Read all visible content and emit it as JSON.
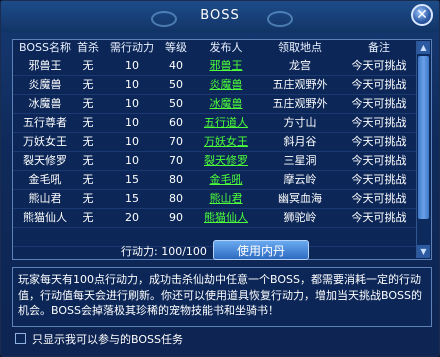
{
  "window": {
    "title": "BOSS",
    "close_glyph": "✕"
  },
  "table": {
    "headers": [
      "BOSS名称",
      "首杀",
      "需行动力",
      "等级",
      "发布人",
      "领取地点",
      "备注"
    ],
    "rows": [
      [
        "邪兽王",
        "无",
        "10",
        "40",
        "邪兽王",
        "龙宫",
        "今天可挑战"
      ],
      [
        "炎魔兽",
        "无",
        "10",
        "50",
        "炎魔兽",
        "五庄观野外",
        "今天可挑战"
      ],
      [
        "冰魔兽",
        "无",
        "10",
        "50",
        "冰魔兽",
        "五庄观野外",
        "今天可挑战"
      ],
      [
        "五行尊者",
        "无",
        "10",
        "60",
        "五行道人",
        "方寸山",
        "今天可挑战"
      ],
      [
        "万妖女王",
        "无",
        "10",
        "70",
        "万妖女王",
        "斜月谷",
        "今天可挑战"
      ],
      [
        "裂天修罗",
        "无",
        "10",
        "70",
        "裂天修罗",
        "三星洞",
        "今天可挑战"
      ],
      [
        "金毛吼",
        "无",
        "15",
        "80",
        "金毛吼",
        "摩云岭",
        "今天可挑战"
      ],
      [
        "熊山君",
        "无",
        "15",
        "80",
        "熊山君",
        "幽冥血海",
        "今天可挑战"
      ],
      [
        "熊猫仙人",
        "无",
        "20",
        "90",
        "熊猫仙人",
        "狮驼岭",
        "今天可挑战"
      ],
      [
        "",
        "",
        "",
        "",
        "",
        "",
        ""
      ]
    ]
  },
  "action_power": {
    "label": "行动力: 100/100"
  },
  "use_button": {
    "label": "使用内丹"
  },
  "description": {
    "text": "玩家每天有100点行动力，成功击杀仙劫中任意一个BOSS，都需要消耗一定的行动值，行动值每天会进行刷新。你还可以使用道具恢复行动力，增加当天挑战BOSS的机会。BOSS会掉落极其珍稀的宠物技能书和坐骑书！"
  },
  "filter": {
    "label": "只显示我可以参与的BOSS任务",
    "checked": false
  },
  "colors": {
    "link_green": "#4cff38",
    "panel_bg": "#0b2657",
    "title_bar": "#1d4c8a"
  }
}
